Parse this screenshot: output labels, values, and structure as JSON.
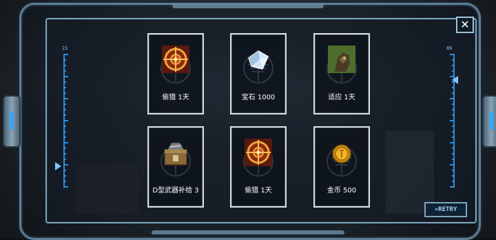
{
  "gauges": {
    "left": {
      "number": "21",
      "level": 0.15
    },
    "right": {
      "number": "86",
      "level": 0.8
    }
  },
  "close": {
    "glyph": "✕",
    "icon": "close-icon"
  },
  "rewards": [
    {
      "label": "偷猎 1天",
      "icon": "crosshair-bullseye-icon"
    },
    {
      "label": "宝石 1000",
      "icon": "diamond-gem-icon"
    },
    {
      "label": "适应 1天",
      "icon": "camouflage-soldier-icon"
    },
    {
      "label": "D型武器补给 3",
      "icon": "weapon-supply-crate-icon"
    },
    {
      "label": "偷猎 1天",
      "icon": "crosshair-bullseye-icon"
    },
    {
      "label": "金币 500",
      "icon": "gold-coin-icon"
    }
  ],
  "retry": {
    "label": "»RETRY"
  },
  "colors": {
    "accent": "#2a8fe0",
    "frame": "#7fa5bf",
    "card_border": "#d9dee3"
  }
}
